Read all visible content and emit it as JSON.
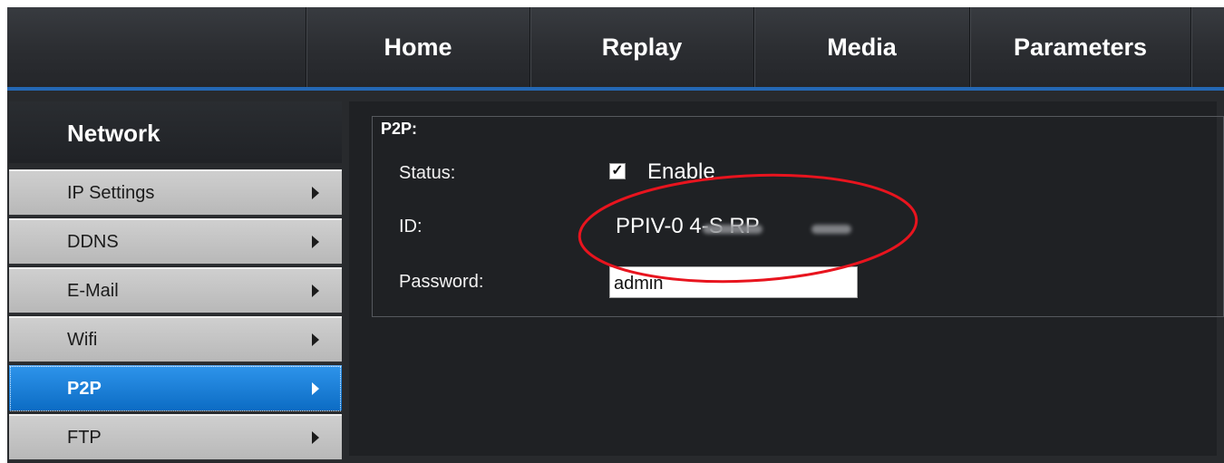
{
  "topnav": {
    "tabs": [
      {
        "label": "Home"
      },
      {
        "label": "Replay"
      },
      {
        "label": "Media"
      },
      {
        "label": "Parameters"
      }
    ]
  },
  "sidebar": {
    "header": "Network",
    "items": [
      {
        "label": "IP Settings"
      },
      {
        "label": "DDNS"
      },
      {
        "label": "E-Mail"
      },
      {
        "label": "Wifi"
      },
      {
        "label": "P2P",
        "active": true
      },
      {
        "label": "FTP"
      }
    ]
  },
  "p2p": {
    "title": "P2P:",
    "status_label": "Status:",
    "status_checked": true,
    "enable_label": "Enable",
    "id_label": "ID:",
    "id_value": "PPIV-0          4-S        RP",
    "password_label": "Password:",
    "password_value": "admin"
  },
  "colors": {
    "accent": "#2468b4",
    "active_item": "#1a80d8",
    "annotation": "#e8141e"
  }
}
